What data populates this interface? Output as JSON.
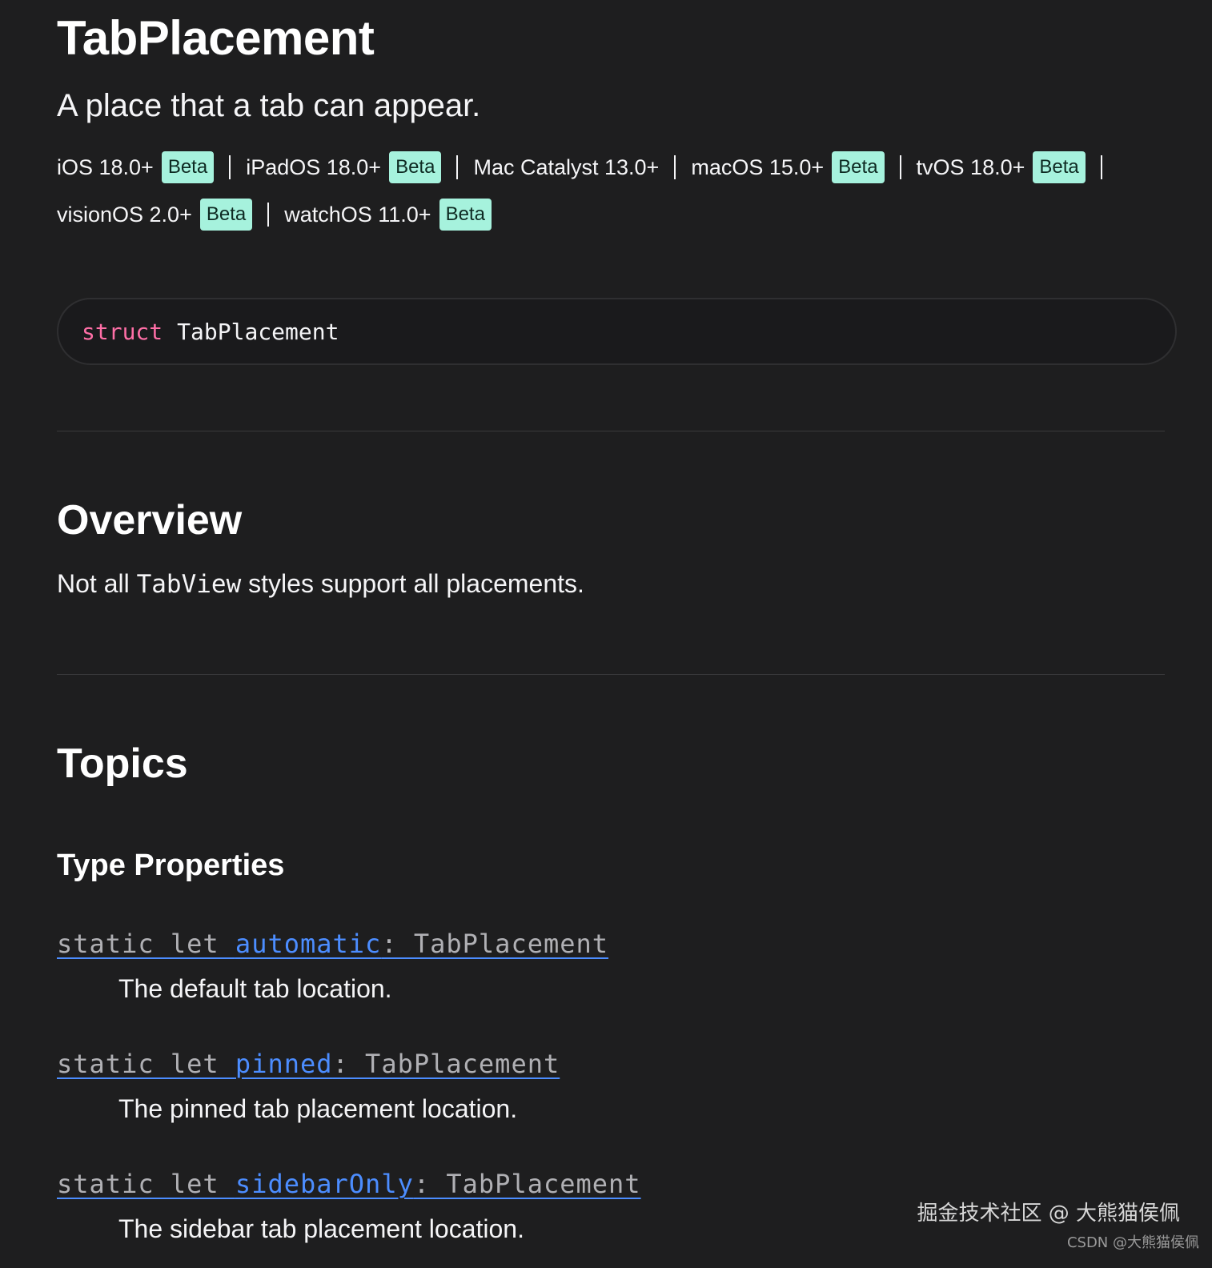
{
  "page": {
    "title": "TabPlacement",
    "abstract": "A place that a tab can appear."
  },
  "availability": {
    "row1": [
      {
        "name": "iOS 18.0+",
        "badge": "Beta"
      },
      {
        "name": "iPadOS 18.0+",
        "badge": "Beta"
      },
      {
        "name": "Mac Catalyst 13.0+",
        "badge": ""
      },
      {
        "name": "macOS 15.0+",
        "badge": "Beta"
      },
      {
        "name": "tvOS 18.0+",
        "badge": "Beta"
      }
    ],
    "row2": [
      {
        "name": "visionOS 2.0+",
        "badge": "Beta"
      },
      {
        "name": "watchOS 11.0+",
        "badge": "Beta"
      }
    ]
  },
  "declaration": {
    "keyword": "struct",
    "name": "TabPlacement"
  },
  "overview": {
    "heading": "Overview",
    "text_before": "Not all ",
    "code": "TabView",
    "text_after": " styles support all placements."
  },
  "topics": {
    "heading": "Topics",
    "group_heading": "Type Properties",
    "items": [
      {
        "prefix": "static let ",
        "name": "automatic",
        "suffix": ": TabPlacement",
        "description": "The default tab location."
      },
      {
        "prefix": "static let ",
        "name": "pinned",
        "suffix": ": TabPlacement",
        "description": "The pinned tab placement location."
      },
      {
        "prefix": "static let ",
        "name": "sidebarOnly",
        "suffix": ": TabPlacement",
        "description": "The sidebar tab placement location."
      }
    ]
  },
  "watermark": {
    "main": "掘金技术社区 @ 大熊猫侯佩",
    "small": "CSDN @大熊猫侯佩"
  },
  "colors": {
    "background": "#1e1e1f",
    "beta_badge": "#a6f2dd",
    "keyword": "#ff6fa7",
    "link": "#4c8dff"
  }
}
